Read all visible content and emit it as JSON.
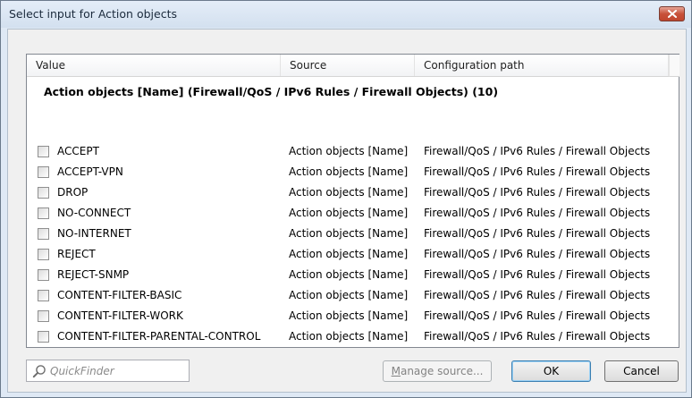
{
  "window": {
    "title": "Select input for Action objects"
  },
  "list": {
    "columns": [
      "Value",
      "Source",
      "Configuration path"
    ],
    "group_header": "Action objects [Name] (Firewall/QoS / IPv6 Rules / Firewall Objects) (10)",
    "rows": [
      {
        "value": "ACCEPT",
        "source": "Action objects [Name]",
        "path": "Firewall/QoS / IPv6 Rules / Firewall Objects",
        "checked": false
      },
      {
        "value": "ACCEPT-VPN",
        "source": "Action objects [Name]",
        "path": "Firewall/QoS / IPv6 Rules / Firewall Objects",
        "checked": false
      },
      {
        "value": "DROP",
        "source": "Action objects [Name]",
        "path": "Firewall/QoS / IPv6 Rules / Firewall Objects",
        "checked": false
      },
      {
        "value": "NO-CONNECT",
        "source": "Action objects [Name]",
        "path": "Firewall/QoS / IPv6 Rules / Firewall Objects",
        "checked": false
      },
      {
        "value": "NO-INTERNET",
        "source": "Action objects [Name]",
        "path": "Firewall/QoS / IPv6 Rules / Firewall Objects",
        "checked": false
      },
      {
        "value": "REJECT",
        "source": "Action objects [Name]",
        "path": "Firewall/QoS / IPv6 Rules / Firewall Objects",
        "checked": false
      },
      {
        "value": "REJECT-SNMP",
        "source": "Action objects [Name]",
        "path": "Firewall/QoS / IPv6 Rules / Firewall Objects",
        "checked": false
      },
      {
        "value": "CONTENT-FILTER-BASIC",
        "source": "Action objects [Name]",
        "path": "Firewall/QoS / IPv6 Rules / Firewall Objects",
        "checked": false
      },
      {
        "value": "CONTENT-FILTER-WORK",
        "source": "Action objects [Name]",
        "path": "Firewall/QoS / IPv6 Rules / Firewall Objects",
        "checked": false
      },
      {
        "value": "CONTENT-FILTER-PARENTAL-CONTROL",
        "source": "Action objects [Name]",
        "path": "Firewall/QoS / IPv6 Rules / Firewall Objects",
        "checked": false
      }
    ]
  },
  "footer": {
    "quickfinder_placeholder": "QuickFinder",
    "manage_source_label_accel": "M",
    "manage_source_label_rest": "anage source...",
    "ok_label": "OK",
    "cancel_label": "Cancel"
  },
  "icons": {
    "close": "close-icon",
    "search": "search-icon",
    "checkbox": "checkbox-icon"
  },
  "colors": {
    "close_button": "#c8523b",
    "default_button_border": "#3c7fb1"
  }
}
